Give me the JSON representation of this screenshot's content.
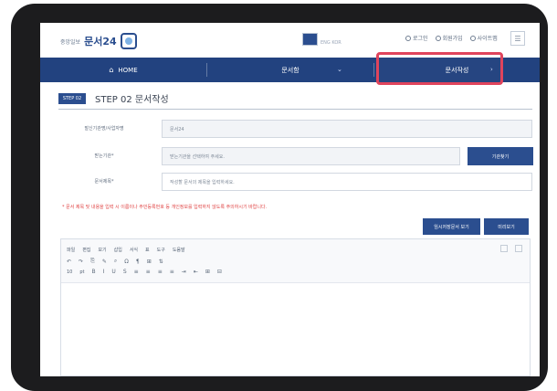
{
  "header": {
    "logo_small": "중앙일보",
    "logo_main": "문서24",
    "language_small": "ENG KOR",
    "top_links": [
      {
        "label": "로그인",
        "icon": "user-icon"
      },
      {
        "label": "회원가입",
        "icon": "user-plus-icon"
      },
      {
        "label": "사이트맵",
        "icon": "sitemap-icon"
      }
    ],
    "menu_icon": "menu-icon"
  },
  "nav": {
    "items": [
      {
        "label": "HOME",
        "icon": "home-icon"
      },
      {
        "label": "문서함",
        "has_arrow": true
      },
      {
        "label": "문서작성",
        "has_arrow": true
      }
    ]
  },
  "page": {
    "step_badge": "STEP 02",
    "step_title": "STEP 02 문서작성"
  },
  "form": {
    "rows": [
      {
        "label": "발신기관명/사업자명",
        "value": "문서24"
      },
      {
        "label": "받는기관*",
        "placeholder": "받는기관을 선택하여 주세요."
      },
      {
        "label": "문서제목*",
        "placeholder": "작성할 문서의 제목을 입력하세요."
      }
    ],
    "search_button": "기관찾기"
  },
  "notice": "* 문서 제목 및 내용을 입력 시 이름이나 주민등록번호 등 개인정보를 입력하지 않도록 주의하시기 바랍니다.",
  "buttons": {
    "temp_save": "임시저장문서 보기",
    "preview": "미리보기"
  },
  "editor": {
    "toolbar_row1": [
      "파일",
      "편집",
      "보기",
      "삽입",
      "서식",
      "표",
      "도구",
      "도움말"
    ],
    "toolbar_row2": [
      "↶",
      "↷",
      "⎘",
      "✎",
      "⌕",
      "Ω",
      "¶",
      "⊞",
      "⇅"
    ],
    "toolbar_row3": [
      "10",
      "pt",
      "B",
      "I",
      "U",
      "S",
      "≡",
      "≡",
      "≡",
      "≡",
      "⇥",
      "⇤",
      "⊞",
      "⊟"
    ]
  },
  "colors": {
    "nav": "#22427f",
    "accent": "#2b4e8f",
    "highlight_box": "#e0445c",
    "notice_text": "#e04444",
    "device": "#1c1c1e"
  }
}
